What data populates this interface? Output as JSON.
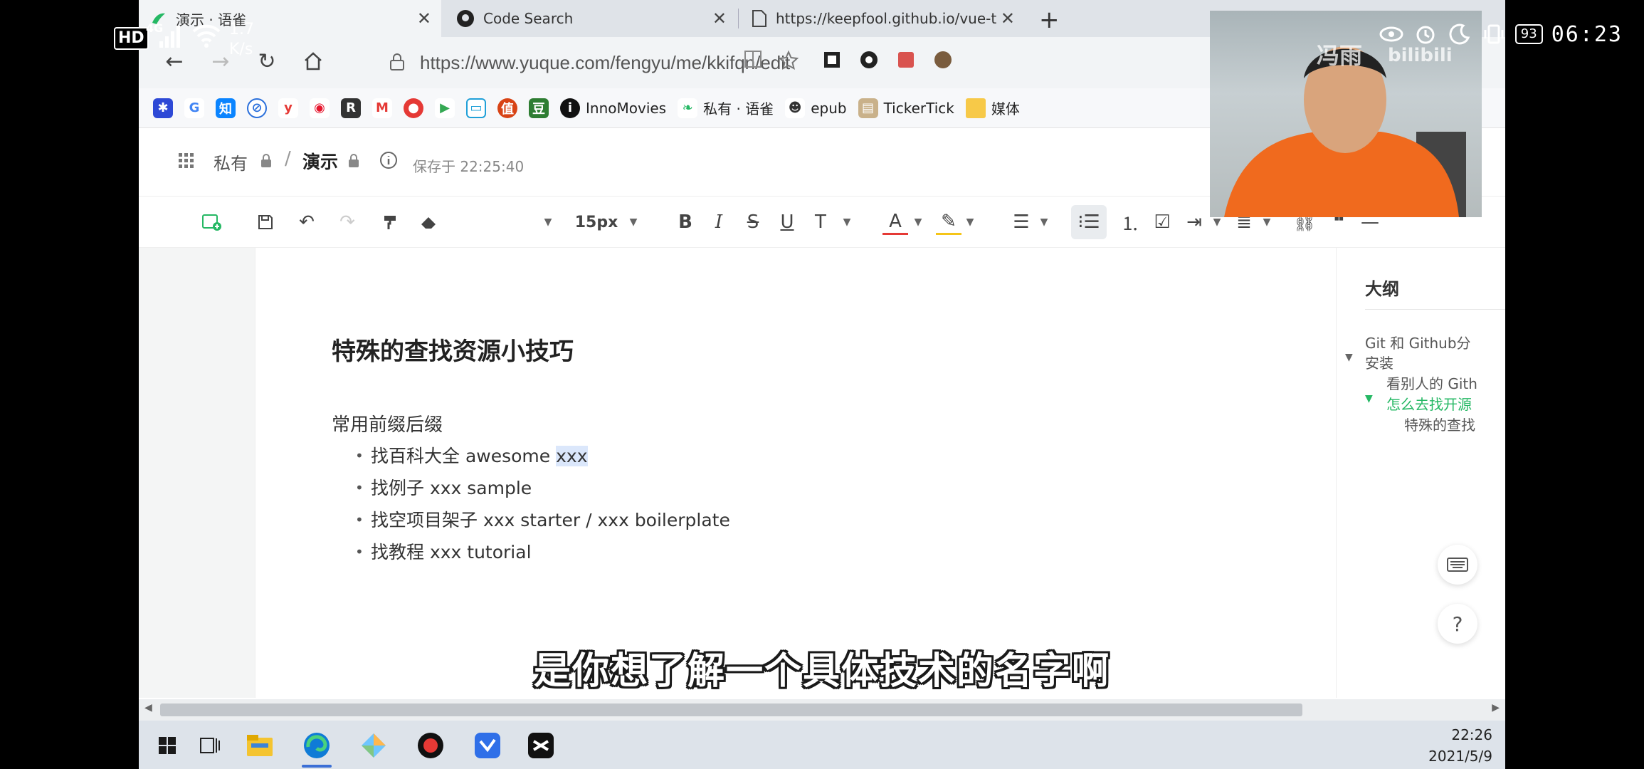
{
  "phone_status": {
    "hd": "HD",
    "network": "4G",
    "net_speed_value": "1.7",
    "net_speed_unit": "K/s",
    "battery": "93",
    "time": "06:23"
  },
  "browser": {
    "tabs": [
      {
        "label": "演示 · 语雀",
        "active": true
      },
      {
        "label": "Code Search",
        "active": false
      },
      {
        "label": "https://keepfool.github.io/vue-t",
        "active": false
      }
    ],
    "url": "https://www.yuque.com/fengyu/me/kkifqn/edit",
    "bookmarks": [
      {
        "icon": "baidu-icon",
        "label": ""
      },
      {
        "icon": "google-icon",
        "label": ""
      },
      {
        "icon": "zhihu-icon",
        "label": ""
      },
      {
        "icon": "link-icon",
        "label": ""
      },
      {
        "icon": "y-icon",
        "label": ""
      },
      {
        "icon": "weibo-icon",
        "label": ""
      },
      {
        "icon": "r-icon",
        "label": ""
      },
      {
        "icon": "gmail-icon",
        "label": ""
      },
      {
        "icon": "map-pin-icon",
        "label": ""
      },
      {
        "icon": "play-icon",
        "label": ""
      },
      {
        "icon": "bilibili-icon",
        "label": ""
      },
      {
        "icon": "zhi-icon",
        "label": ""
      },
      {
        "icon": "douban-icon",
        "label": ""
      },
      {
        "icon": "inno-icon",
        "label": "InnoMovies"
      },
      {
        "icon": "yuque-icon",
        "label": "私有 · 语雀"
      },
      {
        "icon": "epub-icon",
        "label": "epub"
      },
      {
        "icon": "tickertick-icon",
        "label": "TickerTick"
      },
      {
        "icon": "folder-icon",
        "label": "媒体"
      }
    ]
  },
  "doc_header": {
    "crumb_private": "私有",
    "crumb_doc": "演示",
    "save_status": "保存于 22:25:40"
  },
  "toolbar": {
    "font_size": "15px"
  },
  "document": {
    "title": "特殊的查找资源小技巧",
    "paragraph": "常用前缀后缀",
    "items": [
      {
        "text": "找百科大全 awesome ",
        "highlight": "xxx"
      },
      {
        "text": "找例子 xxx sample",
        "highlight": ""
      },
      {
        "text": "找空项目架子 xxx starter / xxx boilerplate",
        "highlight": ""
      },
      {
        "text": "找教程  xxx tutorial",
        "highlight": ""
      }
    ]
  },
  "outline": {
    "title": "大纲",
    "items": [
      {
        "label": "Git 和 Github分"
      },
      {
        "label": "安装"
      },
      {
        "label": "看别人的 Gith"
      },
      {
        "label": "怎么去找开源"
      },
      {
        "label": "特殊的查找"
      }
    ]
  },
  "taskbar": {
    "time": "22:26",
    "date": "2021/5/9"
  },
  "webcam": {
    "watermark_name": "冯雨",
    "watermark_logo": "bilibili"
  },
  "subtitle": "是你想了解一个具体技术的名字啊",
  "colors": {
    "accent_green": "#25b864",
    "tab_bar": "#dfe3e8",
    "taskbar": "#dde3ea"
  }
}
